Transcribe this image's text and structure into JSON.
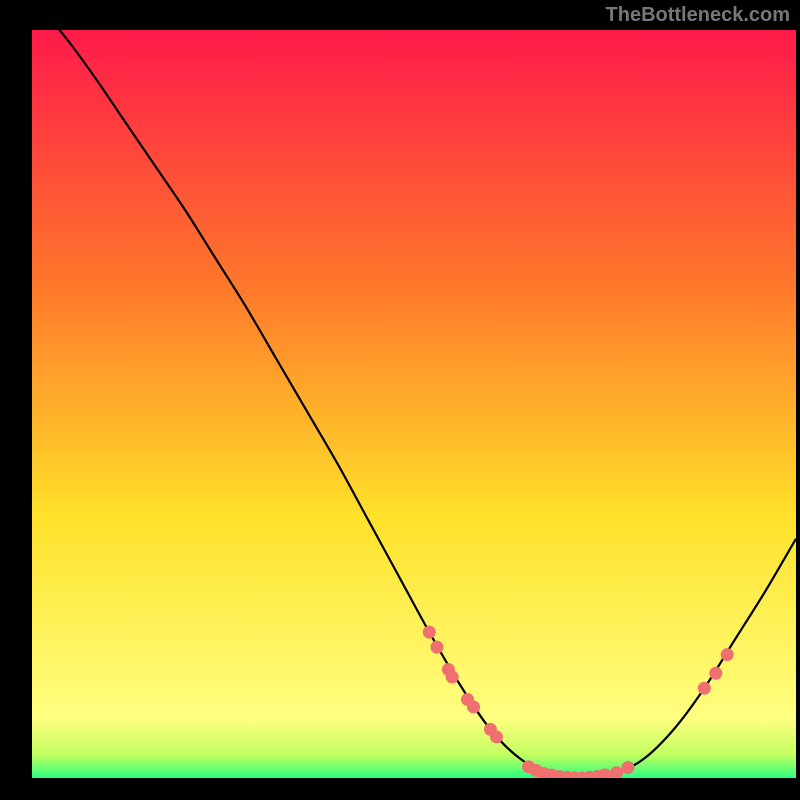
{
  "watermark": "TheBottleneck.com",
  "colors": {
    "background": "#000000",
    "gradient_top": "#ff1a4a",
    "gradient_mid1": "#ff7a2a",
    "gradient_mid2": "#ffe12a",
    "gradient_bottom_yellow": "#ffff80",
    "gradient_green": "#2aff80",
    "curve": "#000000",
    "marker": "#f07070"
  },
  "chart_data": {
    "type": "line",
    "title": "",
    "xlabel": "",
    "ylabel": "",
    "xlim": [
      0,
      100
    ],
    "ylim": [
      0,
      100
    ],
    "series": [
      {
        "name": "curve",
        "x": [
          0,
          4,
          8,
          12,
          16,
          20,
          24,
          28,
          32,
          36,
          40,
          44,
          48,
          52,
          56,
          60,
          64,
          68,
          72,
          76,
          80,
          84,
          88,
          92,
          96,
          100
        ],
        "y": [
          104,
          99.5,
          94,
          88,
          82,
          76,
          69.5,
          63,
          56,
          49,
          42,
          34.5,
          27,
          19.5,
          12.5,
          6.5,
          2.5,
          0.5,
          0,
          0.5,
          2.5,
          6.5,
          12,
          18.5,
          25,
          32
        ]
      }
    ],
    "markers": [
      {
        "x": 52,
        "y": 19.5
      },
      {
        "x": 53,
        "y": 17.5
      },
      {
        "x": 54.5,
        "y": 14.5
      },
      {
        "x": 55,
        "y": 13.5
      },
      {
        "x": 57,
        "y": 10.5
      },
      {
        "x": 57.8,
        "y": 9.5
      },
      {
        "x": 60,
        "y": 6.5
      },
      {
        "x": 60.8,
        "y": 5.5
      },
      {
        "x": 65,
        "y": 1.5
      },
      {
        "x": 66,
        "y": 1.0
      },
      {
        "x": 67,
        "y": 0.6
      },
      {
        "x": 68,
        "y": 0.4
      },
      {
        "x": 69,
        "y": 0.2
      },
      {
        "x": 70,
        "y": 0.1
      },
      {
        "x": 71,
        "y": 0.05
      },
      {
        "x": 72,
        "y": 0.0
      },
      {
        "x": 73,
        "y": 0.1
      },
      {
        "x": 74,
        "y": 0.2
      },
      {
        "x": 75,
        "y": 0.4
      },
      {
        "x": 76.5,
        "y": 0.7
      },
      {
        "x": 78,
        "y": 1.4
      },
      {
        "x": 88,
        "y": 12
      },
      {
        "x": 89.5,
        "y": 14
      },
      {
        "x": 91,
        "y": 16.5
      }
    ],
    "green_band": {
      "y_min": 0,
      "y_max": 3
    }
  }
}
